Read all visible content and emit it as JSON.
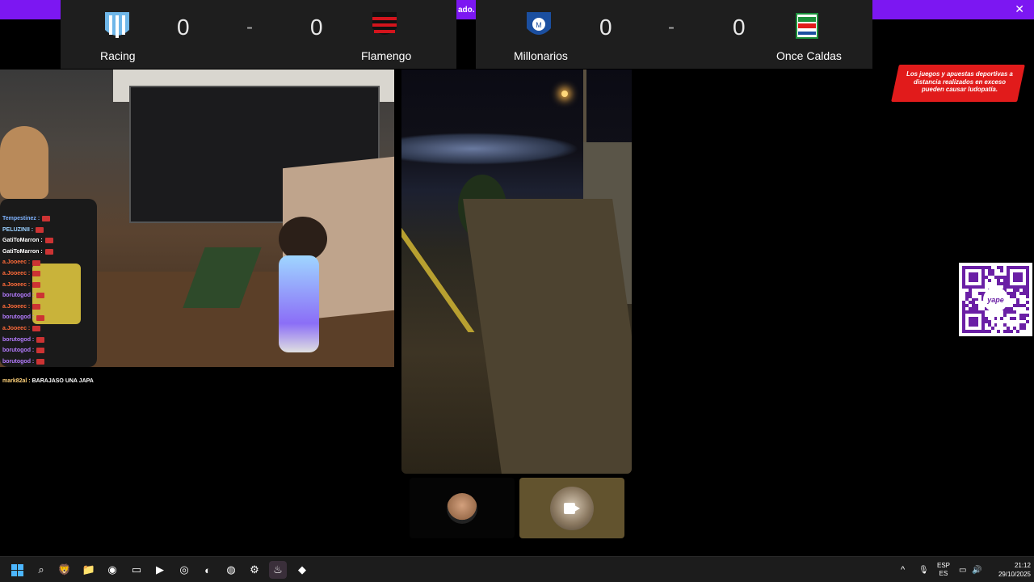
{
  "banner": {
    "text": "ado. L",
    "close": "✕",
    "color": "#7c17f2"
  },
  "matches": [
    {
      "home": "Racing",
      "away": "Flamengo",
      "home_score": "0",
      "away_score": "0",
      "separator": "-"
    },
    {
      "home": "Millonarios",
      "away": "Once Caldas",
      "home_score": "0",
      "away_score": "0",
      "separator": "-"
    }
  ],
  "chat": {
    "lines": [
      {
        "user": "Tempestinez :",
        "color": "#7fb3ff"
      },
      {
        "user": "PELUZINII :",
        "color": "#9ad0ff"
      },
      {
        "user": "GatiToMarron :",
        "color": "#ffffff"
      },
      {
        "user": "GatiToMarron :",
        "color": "#ffffff"
      },
      {
        "user": "a.Jooeec :",
        "color": "#ff6b3a"
      },
      {
        "user": "a.Jooeec :",
        "color": "#ff6b3a"
      },
      {
        "user": "a.Jooeec :",
        "color": "#ff6b3a"
      },
      {
        "user": "borutogod :",
        "color": "#b57cff"
      },
      {
        "user": "a.Jooeec :",
        "color": "#ff6b3a"
      },
      {
        "user": "borutogod :",
        "color": "#b57cff"
      },
      {
        "user": "a.Jooeec :",
        "color": "#ff6b3a"
      },
      {
        "user": "borutogod :",
        "color": "#b57cff"
      },
      {
        "user": "borutogod :",
        "color": "#b57cff"
      },
      {
        "user": "borutogod :",
        "color": "#b57cff"
      }
    ],
    "last": {
      "user": "mark82al :",
      "message": "BARAJASO UNA JAPA",
      "color": "#ffd27a"
    }
  },
  "warning": {
    "text": "Los juegos y apuestas deportivas a distancia realizados en exceso pueden causar ludopatía."
  },
  "qr": {
    "label": "yape"
  },
  "taskbar": {
    "icons": [
      {
        "name": "start-button",
        "glyph": ""
      },
      {
        "name": "search-icon",
        "glyph": "⌕"
      },
      {
        "name": "brave-browser-icon",
        "glyph": "🦁"
      },
      {
        "name": "file-explorer-icon",
        "glyph": "📁"
      },
      {
        "name": "obs-icon",
        "glyph": "◉"
      },
      {
        "name": "media-player-icon",
        "glyph": "▭"
      },
      {
        "name": "streamlabs-icon",
        "glyph": "▶"
      },
      {
        "name": "controller-app-icon",
        "glyph": "◎"
      },
      {
        "name": "discord-icon",
        "glyph": "◐"
      },
      {
        "name": "chrome-icon",
        "glyph": "◍"
      },
      {
        "name": "settings-icon",
        "glyph": "⚙"
      },
      {
        "name": "steam-icon",
        "glyph": "♨"
      },
      {
        "name": "dota-icon",
        "glyph": "◆"
      }
    ],
    "tray": {
      "chevron": "^",
      "mic": "🎙",
      "lang_top": "ESP",
      "lang_bottom": "ES"
    },
    "time": "21:12",
    "date": "29/10/2025"
  }
}
